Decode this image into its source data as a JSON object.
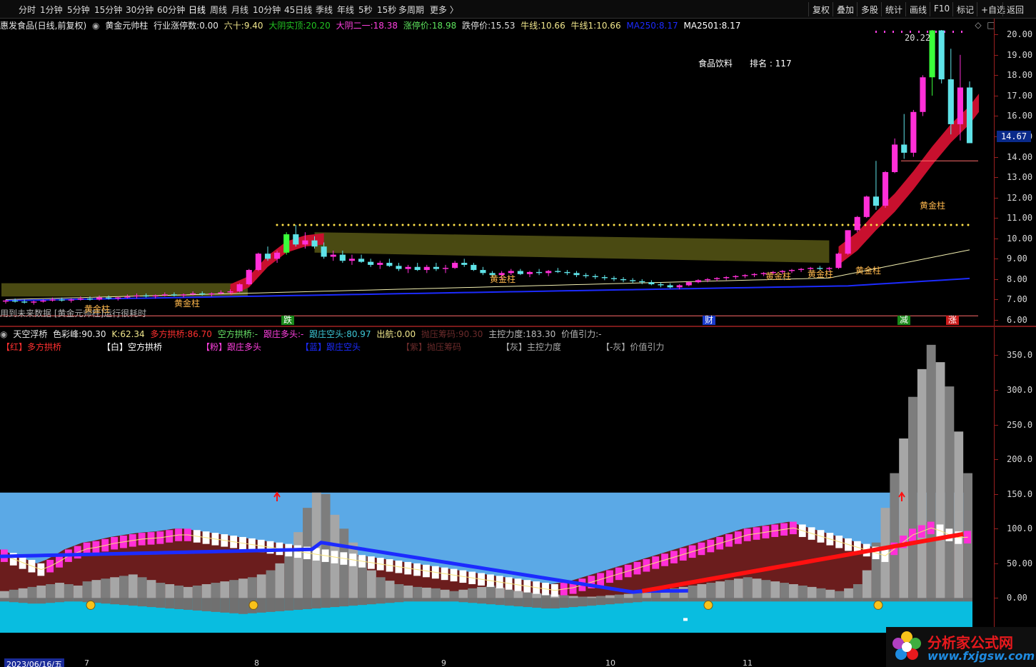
{
  "toolbar": {
    "periods": [
      "分时",
      "1分钟",
      "5分钟",
      "15分钟",
      "30分钟",
      "60分钟",
      "日线",
      "周线",
      "月线",
      "10分钟",
      "45日线",
      "季线",
      "年线",
      "5秒",
      "15秒",
      "多周期",
      "更多 〉"
    ],
    "active_period": "日线",
    "right_buttons": [
      "复权",
      "叠加",
      "多股",
      "统计",
      "画线",
      "F10",
      "标记",
      "+自选",
      "返回"
    ]
  },
  "main_legend": {
    "stock": "惠发食品(日线,前复权)",
    "indicator": "黄金元帅柱",
    "industry_limit_label": "行业涨停数:",
    "industry_limit_value": "0.00",
    "sixty_label": "六十:",
    "sixty_value": "9.40",
    "big_yin_label": "大阴实顶:",
    "big_yin_value": "20.20",
    "big_yin2_label": "大阴二一:",
    "big_yin2_value": "18.38",
    "limit_up_label": "涨停价:",
    "limit_up_value": "18.98",
    "limit_down_label": "跌停价:",
    "limit_down_value": "15.53",
    "bull_label": "牛线:",
    "bull_value": "10.66",
    "bull1_label": "牛线1:",
    "bull1_value": "10.66",
    "ma250_label": "MA250:",
    "ma250_value": "8.17",
    "ma2501_label": "MA2501:",
    "ma2501_value": "8.17"
  },
  "main_annotations": {
    "sector": "食品饮料",
    "rank": "排名 : 117",
    "peak": "20.22",
    "current_price": "14.67",
    "gold_label": "黄金柱",
    "overlay_note": "用到未来数据  [黄金元帅柱]运行很耗时",
    "markers": [
      {
        "text": "跌",
        "color": "#1a8a1a"
      },
      {
        "text": "财",
        "color": "#1a3acc"
      },
      {
        "text": "减",
        "color": "#1a8a1a"
      },
      {
        "text": "涨",
        "color": "#cc1a1a"
      }
    ]
  },
  "main_axis": {
    "ticks": [
      "20.00",
      "19.00",
      "18.00",
      "17.00",
      "16.00",
      "15.00",
      "14.00",
      "13.00",
      "12.00",
      "11.00",
      "10.00",
      "9.00",
      "8.00",
      "7.00",
      "6.00"
    ]
  },
  "sub_legend": {
    "name": "天空浮桥",
    "color_peak_label": "色彩峰:",
    "color_peak_value": "90.30",
    "k_label": "K:",
    "k_value": "62.34",
    "multi_bridge_label": "多方拱桥:",
    "multi_bridge_value": "86.70",
    "short_bridge_label": "空方拱桥:",
    "short_bridge_value": "-",
    "follow_long_label": "跟庄多头:",
    "follow_long_value": "-",
    "follow_short_label": "跟庄空头:",
    "follow_short_value": "80.97",
    "exit_label": "出航:",
    "exit_value": "0.00",
    "pressure_label": "抛压筹码:",
    "pressure_value": "90.30",
    "control_label": "主控力度:",
    "control_value": "183.30",
    "value_pull_label": "价值引力:",
    "value_pull_value": "-"
  },
  "sub_key": {
    "red": "【红】多方拱桥",
    "white": "【白】空方拱桥",
    "pink": "【粉】跟庄多头",
    "blue": "【蓝】跟庄空头",
    "purple": "【紫】抛压筹码",
    "gray": "【灰】主控力度",
    "neg_gray": "【-灰】价值引力"
  },
  "sub_axis": {
    "ticks": [
      "350.0",
      "300.0",
      "250.0",
      "200.0",
      "150.0",
      "100.0",
      "50.00",
      "0.00"
    ]
  },
  "date_axis": {
    "start": "2023/06/16/五",
    "months": [
      "7",
      "8",
      "9",
      "10",
      "11"
    ]
  },
  "watermark": {
    "title": "分析家公式网",
    "url": "www.fxjgsw.com"
  },
  "colors": {
    "up_candle": "#ff2fd8",
    "down_candle": "#5fe3e8",
    "limit_up_candle": "#3aff3a",
    "red_band": "#c8102e",
    "olive_band": "#4a4a12",
    "ma_yellow": "#f2efb0",
    "ma_blue": "#1c2bff",
    "sky_blue": "#5ba9e6",
    "cyan_base": "#09bde0",
    "maroon": "#6b1d1d",
    "gray_bar": "#a6a6a6"
  },
  "chart_data": [
    {
      "type": "candlestick",
      "title": "惠发食品(日线,前复权)",
      "ylim": [
        6.0,
        20.5
      ],
      "y_ticks": [
        20,
        19,
        18,
        17,
        16,
        15,
        14,
        13,
        12,
        11,
        10,
        9,
        8,
        7,
        6
      ],
      "annotations": {
        "high": 20.22,
        "current": 14.67,
        "resistance": 10.66
      },
      "ohlc": [
        [
          6.9,
          7.0,
          6.8,
          6.95
        ],
        [
          6.95,
          7.05,
          6.85,
          6.9
        ],
        [
          6.9,
          7.0,
          6.8,
          6.85
        ],
        [
          6.85,
          6.95,
          6.75,
          6.9
        ],
        [
          6.9,
          7.0,
          6.85,
          6.95
        ],
        [
          6.95,
          7.1,
          6.9,
          7.0
        ],
        [
          7.0,
          7.1,
          6.9,
          6.95
        ],
        [
          6.95,
          7.05,
          6.85,
          7.0
        ],
        [
          7.0,
          7.15,
          6.95,
          7.05
        ],
        [
          7.05,
          7.15,
          6.95,
          7.0
        ],
        [
          7.0,
          7.2,
          6.95,
          7.1
        ],
        [
          7.1,
          7.2,
          7.0,
          7.05
        ],
        [
          7.05,
          7.15,
          6.95,
          7.1
        ],
        [
          7.1,
          7.25,
          7.05,
          7.15
        ],
        [
          7.15,
          7.3,
          7.05,
          7.2
        ],
        [
          7.2,
          7.3,
          7.1,
          7.15
        ],
        [
          7.15,
          7.25,
          7.05,
          7.2
        ],
        [
          7.2,
          7.35,
          7.15,
          7.25
        ],
        [
          7.25,
          7.35,
          7.15,
          7.2
        ],
        [
          7.2,
          7.3,
          7.1,
          7.25
        ],
        [
          7.25,
          7.4,
          7.2,
          7.3
        ],
        [
          7.3,
          7.4,
          7.2,
          7.25
        ],
        [
          7.25,
          7.35,
          7.15,
          7.3
        ],
        [
          7.3,
          7.45,
          7.25,
          7.35
        ],
        [
          7.35,
          7.5,
          7.3,
          7.4
        ],
        [
          7.4,
          7.8,
          7.35,
          7.75
        ],
        [
          7.75,
          8.5,
          7.7,
          8.45
        ],
        [
          8.45,
          9.3,
          8.4,
          9.25
        ],
        [
          9.25,
          9.6,
          8.9,
          9.0
        ],
        [
          9.0,
          9.4,
          8.8,
          9.3
        ],
        [
          9.3,
          10.3,
          9.2,
          10.2
        ],
        [
          10.2,
          10.66,
          9.6,
          9.7
        ],
        [
          9.7,
          10.3,
          9.5,
          9.9
        ],
        [
          9.9,
          10.1,
          9.5,
          9.6
        ],
        [
          9.6,
          9.8,
          9.0,
          9.1
        ],
        [
          9.1,
          9.4,
          8.9,
          9.2
        ],
        [
          9.2,
          9.4,
          8.8,
          8.9
        ],
        [
          8.9,
          9.2,
          8.7,
          9.0
        ],
        [
          9.0,
          9.2,
          8.8,
          8.85
        ],
        [
          8.85,
          9.0,
          8.6,
          8.7
        ],
        [
          8.7,
          8.9,
          8.5,
          8.8
        ],
        [
          8.8,
          9.0,
          8.6,
          8.65
        ],
        [
          8.65,
          8.8,
          8.4,
          8.5
        ],
        [
          8.5,
          8.7,
          8.3,
          8.6
        ],
        [
          8.6,
          8.8,
          8.4,
          8.45
        ],
        [
          8.45,
          8.7,
          8.3,
          8.6
        ],
        [
          8.6,
          8.8,
          8.4,
          8.5
        ],
        [
          8.5,
          8.7,
          8.3,
          8.55
        ],
        [
          8.55,
          8.9,
          8.5,
          8.8
        ],
        [
          8.8,
          9.0,
          8.6,
          8.7
        ],
        [
          8.7,
          8.8,
          8.4,
          8.45
        ],
        [
          8.45,
          8.6,
          8.2,
          8.3
        ],
        [
          8.3,
          8.4,
          8.1,
          8.2
        ],
        [
          8.2,
          8.4,
          8.0,
          8.3
        ],
        [
          8.3,
          8.5,
          8.2,
          8.4
        ],
        [
          8.4,
          8.5,
          8.2,
          8.25
        ],
        [
          8.25,
          8.4,
          8.1,
          8.35
        ],
        [
          8.35,
          8.5,
          8.2,
          8.3
        ],
        [
          8.3,
          8.45,
          8.15,
          8.4
        ],
        [
          8.4,
          8.55,
          8.3,
          8.35
        ],
        [
          8.35,
          8.45,
          8.2,
          8.3
        ],
        [
          8.3,
          8.4,
          8.1,
          8.2
        ],
        [
          8.2,
          8.3,
          8.05,
          8.15
        ],
        [
          8.15,
          8.25,
          8.0,
          8.1
        ],
        [
          8.1,
          8.2,
          7.95,
          8.05
        ],
        [
          8.05,
          8.15,
          7.9,
          8.0
        ],
        [
          8.0,
          8.1,
          7.85,
          7.95
        ],
        [
          7.95,
          8.05,
          7.8,
          7.9
        ],
        [
          7.9,
          8.0,
          7.75,
          7.85
        ],
        [
          7.85,
          7.95,
          7.7,
          7.75
        ],
        [
          7.75,
          7.85,
          7.6,
          7.7
        ],
        [
          7.7,
          7.8,
          7.55,
          7.6
        ],
        [
          7.6,
          7.75,
          7.5,
          7.7
        ],
        [
          7.7,
          7.9,
          7.65,
          7.85
        ],
        [
          7.85,
          8.0,
          7.8,
          7.95
        ],
        [
          7.95,
          8.05,
          7.85,
          8.0
        ],
        [
          8.0,
          8.1,
          7.9,
          8.05
        ],
        [
          8.05,
          8.15,
          7.95,
          8.1
        ],
        [
          8.1,
          8.2,
          8.0,
          8.15
        ],
        [
          8.15,
          8.25,
          8.05,
          8.2
        ],
        [
          8.2,
          8.3,
          8.1,
          8.25
        ],
        [
          8.25,
          8.35,
          8.15,
          8.3
        ],
        [
          8.3,
          8.4,
          8.2,
          8.35
        ],
        [
          8.35,
          8.45,
          8.25,
          8.4
        ],
        [
          8.4,
          8.5,
          8.3,
          8.45
        ],
        [
          8.45,
          8.55,
          8.35,
          8.5
        ],
        [
          8.5,
          8.6,
          8.4,
          8.55
        ],
        [
          8.55,
          8.65,
          8.45,
          8.5
        ],
        [
          8.5,
          8.6,
          8.4,
          8.55
        ],
        [
          8.55,
          9.3,
          8.5,
          9.25
        ],
        [
          9.25,
          10.4,
          9.2,
          10.4
        ],
        [
          10.4,
          11.1,
          10.3,
          11.05
        ],
        [
          11.05,
          12.1,
          11.0,
          12.05
        ],
        [
          12.05,
          13.8,
          11.4,
          11.6
        ],
        [
          11.6,
          13.3,
          11.5,
          13.25
        ],
        [
          13.25,
          14.9,
          13.2,
          14.6
        ],
        [
          14.6,
          16.1,
          13.9,
          14.2
        ],
        [
          14.2,
          16.3,
          14.0,
          16.2
        ],
        [
          16.2,
          18.0,
          16.0,
          17.9
        ],
        [
          17.9,
          20.22,
          17.0,
          20.2
        ],
        [
          20.2,
          20.22,
          17.6,
          17.8
        ],
        [
          17.8,
          19.3,
          15.1,
          15.6
        ],
        [
          15.6,
          19.0,
          14.8,
          17.4
        ],
        [
          17.4,
          17.7,
          14.9,
          14.67
        ]
      ],
      "series": [
        {
          "name": "牛线",
          "values": [
            10.66
          ]
        },
        {
          "name": "MA250",
          "values": [
            8.17
          ]
        },
        {
          "name": "MA2501",
          "values": [
            8.17
          ]
        }
      ]
    },
    {
      "type": "bar",
      "title": "天空浮桥",
      "ylim": [
        -50,
        370
      ],
      "y_ticks": [
        350,
        300,
        250,
        200,
        150,
        100,
        50,
        0
      ],
      "series": [
        {
          "name": "主控力度",
          "values": [
            10,
            12,
            14,
            16,
            18,
            20,
            22,
            20,
            18,
            24,
            26,
            28,
            30,
            32,
            34,
            30,
            26,
            22,
            20,
            18,
            16,
            18,
            20,
            22,
            24,
            26,
            28,
            30,
            34,
            40,
            50,
            70,
            95,
            130,
            152,
            150,
            120,
            100,
            80,
            60,
            40,
            30,
            25,
            20,
            18,
            16,
            15,
            14,
            12,
            10,
            12,
            14,
            16,
            18,
            15,
            12,
            10,
            8,
            7,
            6,
            5,
            4,
            3,
            2,
            2,
            3,
            4,
            5,
            6,
            7,
            8,
            10,
            12,
            14,
            16,
            18,
            20,
            22,
            24,
            26,
            28,
            30,
            28,
            26,
            24,
            22,
            20,
            18,
            16,
            14,
            12,
            10,
            14,
            20,
            40,
            80,
            130,
            180,
            230,
            290,
            330,
            365,
            340,
            305,
            240,
            180
          ]
        },
        {
          "name": "多方拱桥",
          "values": [
            60,
            55,
            50,
            45,
            40,
            45,
            52,
            60,
            65,
            70,
            72,
            75,
            78,
            80,
            82,
            84,
            85,
            86,
            88,
            90,
            90,
            88,
            86,
            84,
            82,
            80,
            78,
            76,
            74,
            72,
            70,
            68,
            66,
            64,
            62,
            60,
            58,
            56,
            54,
            52,
            50,
            48,
            46,
            44,
            42,
            40,
            38,
            36,
            34,
            32,
            30,
            28,
            26,
            24,
            22,
            20,
            18,
            16,
            14,
            12,
            10,
            12,
            14,
            18,
            22,
            26,
            30,
            34,
            38,
            42,
            46,
            50,
            54,
            58,
            62,
            66,
            70,
            74,
            78,
            82,
            86,
            90,
            92,
            94,
            96,
            98,
            100,
            96,
            92,
            88,
            84,
            80,
            76,
            72,
            68,
            64,
            60,
            70,
            80,
            90,
            95,
            100,
            96,
            90,
            86,
            86.7
          ]
        },
        {
          "name": "价值引力",
          "values": [
            -5,
            -6,
            -7,
            -8,
            -8,
            -7,
            -6,
            -5,
            -5,
            -6,
            -7,
            -8,
            -9,
            -10,
            -11,
            -12,
            -13,
            -14,
            -15,
            -16,
            -17,
            -18,
            -19,
            -20,
            -21,
            -22,
            -23,
            -22,
            -21,
            -20,
            -19,
            -18,
            -17,
            -16,
            -15,
            -14,
            -13,
            -12,
            -11,
            -10,
            -9,
            -8,
            -7,
            -6,
            -5,
            -5,
            -5,
            -5,
            -5,
            -5,
            -6,
            -7,
            -8,
            -9,
            -10,
            -11,
            -12,
            -13,
            -14,
            -15,
            -15,
            -14,
            -13,
            -12,
            -11,
            -10,
            -9,
            -8,
            -7,
            -6,
            -5,
            -5,
            -5,
            -5,
            -5,
            -5,
            -5,
            -5,
            -5,
            -5,
            -5,
            -5,
            -5,
            -5,
            -5,
            -5,
            -5,
            -5,
            -5,
            -5,
            -5,
            -5,
            -5,
            -5,
            -5,
            -5,
            -5,
            -5,
            -5,
            -5,
            -5,
            -5,
            -5,
            -5,
            -5,
            -5
          ]
        }
      ]
    }
  ]
}
